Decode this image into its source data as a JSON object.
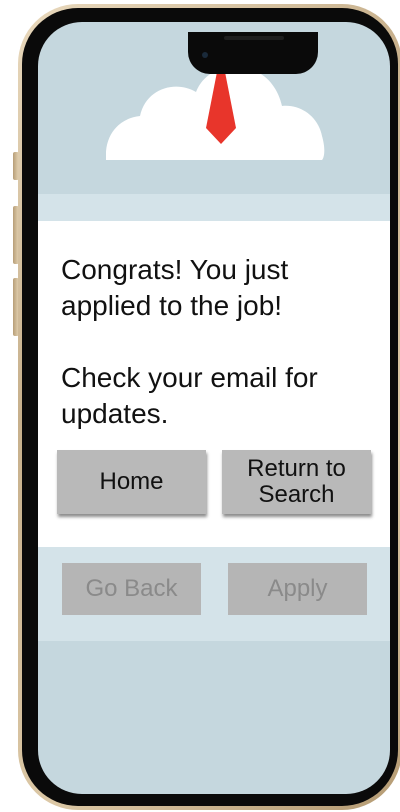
{
  "confirmation": {
    "message": "Congrats! You just\napplied to the job!\n\nCheck your email for\nupdates."
  },
  "actions": {
    "home_label": "Home",
    "return_label": "Return to\nSearch"
  },
  "nav": {
    "go_back_label": "Go Back",
    "apply_label": "Apply"
  },
  "icons": {
    "logo": "cloud-with-necktie-icon"
  },
  "colors": {
    "screen_background": "#c5d7de",
    "band": "#d4e3e9",
    "card": "#ffffff",
    "tie": "#e8352b",
    "button": "#b9b9b9",
    "disabled_text": "#8a8a8a"
  }
}
